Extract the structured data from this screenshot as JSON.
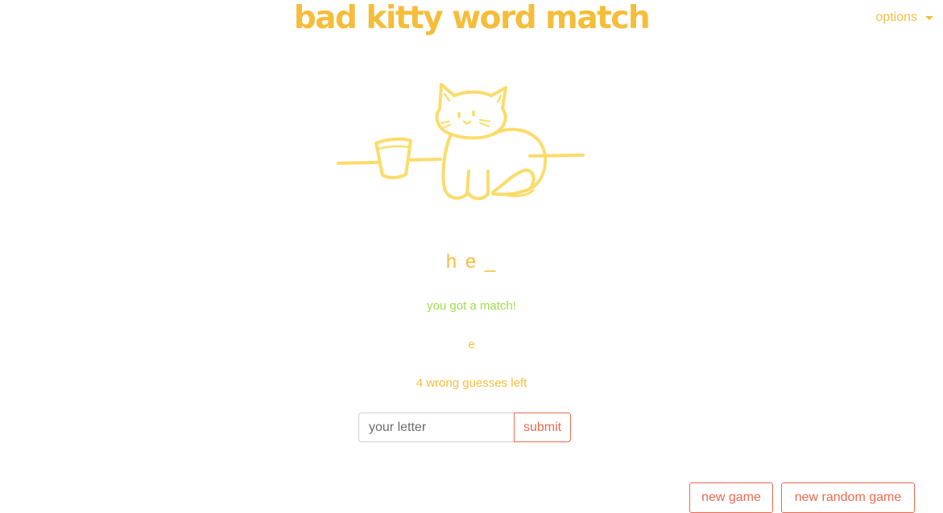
{
  "header": {
    "title": "bad kitty word match",
    "options_label": "options"
  },
  "game": {
    "word_display": "h e _",
    "message": "you got a match!",
    "guessed_letters": "e",
    "wrong_guesses_left": "4 wrong guesses left"
  },
  "form": {
    "input_placeholder": "your letter",
    "input_value": "",
    "submit_label": "submit"
  },
  "footer": {
    "new_game_label": "new game",
    "new_random_game_label": "new random game"
  },
  "colors": {
    "accent": "#f5bd3a",
    "kitty": "#fbdc6a",
    "success": "#9be04b",
    "button": "#ea6a4e"
  },
  "icons": {
    "kitty_illustration": "cat-with-cup-on-table",
    "options_caret": "caret-down-icon"
  }
}
